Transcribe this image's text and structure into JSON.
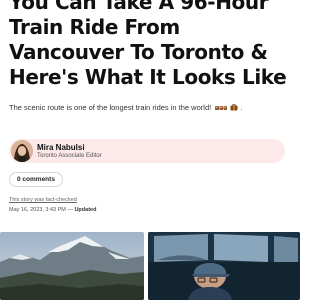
{
  "article": {
    "headline": "You Can Take A 96-Hour Train Ride From Vancouver To Toronto & Here's What It Looks Like",
    "subtitle": "The scenic route is one of the longest train rides in the world!",
    "subtitle_icons": [
      "train-emoji",
      "suitcase-emoji"
    ],
    "author": {
      "name": "Mira Nabulsi",
      "title": "Toronto Associate Editor"
    },
    "comments_label": "0 comments",
    "fact_check_label": "This story was fact-checked",
    "date": "May 16, 2023, 3:43 PM",
    "separator": "—",
    "updated_label": "Updated"
  },
  "colors": {
    "author_card_bg": "#fde9ea",
    "text_primary": "#111111",
    "text_secondary": "#555555"
  },
  "gallery": {
    "photos": [
      {
        "name": "snowy-mountain-photo"
      },
      {
        "name": "person-train-dome-car-photo"
      }
    ]
  }
}
